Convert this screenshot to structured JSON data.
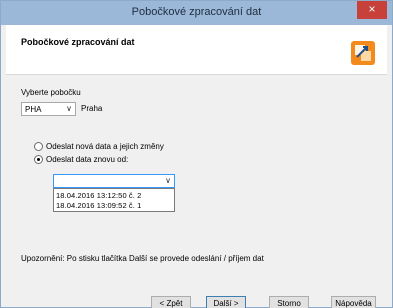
{
  "window": {
    "title": "Pobočkové zpracování dat",
    "close_label": "×"
  },
  "header": {
    "title": "Pobočkové zpracování dat",
    "icon": "wizard-icon"
  },
  "branch": {
    "label": "Vyberte pobočku",
    "code": "PHA",
    "name": "Praha"
  },
  "mode": {
    "option_new": "Odeslat nová data a jejich změny",
    "option_resend": "Odeslat data znovu od:",
    "selected": "option_resend"
  },
  "resend": {
    "selected_value": "",
    "items": [
      "18.04.2016  13:12:50  č.  2",
      "18.04.2016  13:09:52  č.  1"
    ]
  },
  "notice": "Upozornění: Po stisku tlačítka Další se provede odeslání / příjem dat",
  "buttons": {
    "back": "< Zpět",
    "next": "Další >",
    "cancel": "Storno",
    "help": "Nápověda"
  }
}
